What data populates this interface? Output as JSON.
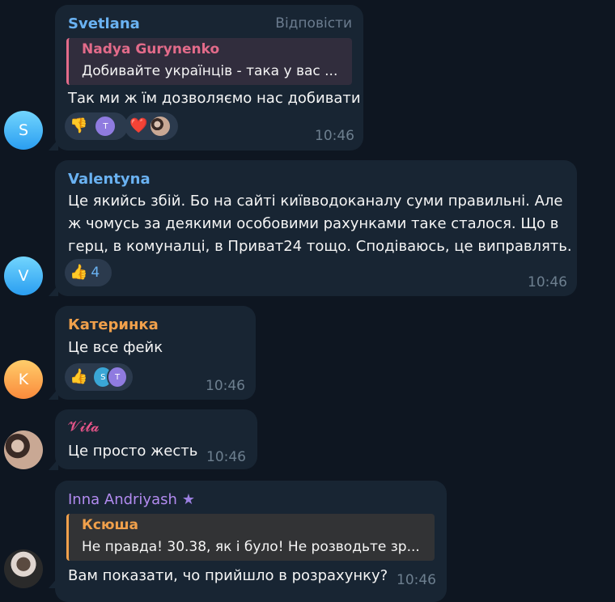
{
  "messages": [
    {
      "id": "svetlana",
      "avatar_letter": "S",
      "name": "Svetlana",
      "name_color": "#6ab2f2",
      "reply_label": "Відповісти",
      "quote": {
        "name": "Nadya Gurynenko",
        "text": "Добивайте українців - така у вас ...",
        "color": "#e36b8a"
      },
      "text": "Так ми ж їм дозволяємо нас добивати",
      "reactions": [
        {
          "emoji": "👎",
          "avatars": [
            "T"
          ]
        },
        {
          "emoji": "❤️",
          "avatars": [
            ""
          ]
        }
      ],
      "time": "10:46"
    },
    {
      "id": "valentyna",
      "avatar_letter": "V",
      "name": "Valentyna",
      "name_color": "#6ab2f2",
      "text_lines": [
        "Це якийсь збій. Бо на сайті київводоканалу суми правильні. Але",
        "ж чомусь за деякими особовими рахунками таке сталося. Що в",
        "герц, в комуналці, в Приват24 тощо. Сподіваюсь, це виправлять."
      ],
      "reactions": [
        {
          "emoji": "👍",
          "count": "4"
        }
      ],
      "time": "10:46"
    },
    {
      "id": "katerynka",
      "avatar_letter": "K",
      "name": "Катеринка",
      "name_color": "#f0a04b",
      "text": "Це все фейк",
      "reactions": [
        {
          "emoji": "👍",
          "avatars": [
            "S",
            "T"
          ]
        }
      ],
      "time": "10:46"
    },
    {
      "id": "vita",
      "name": "𝓥𝓲𝓽𝓪",
      "name_color": "#e8558a",
      "text": "Це просто жесть",
      "time": "10:46"
    },
    {
      "id": "inna",
      "name": "Inna Andriyash",
      "name_color": "#b28bf0",
      "quote": {
        "name": "Ксюша",
        "text": "Не правда! 30.38, як і було! Не розводьте зр...",
        "color": "#f0a04b"
      },
      "text": "Вам показати, чо прийшло в розрахунку?",
      "time": "10:46"
    }
  ]
}
